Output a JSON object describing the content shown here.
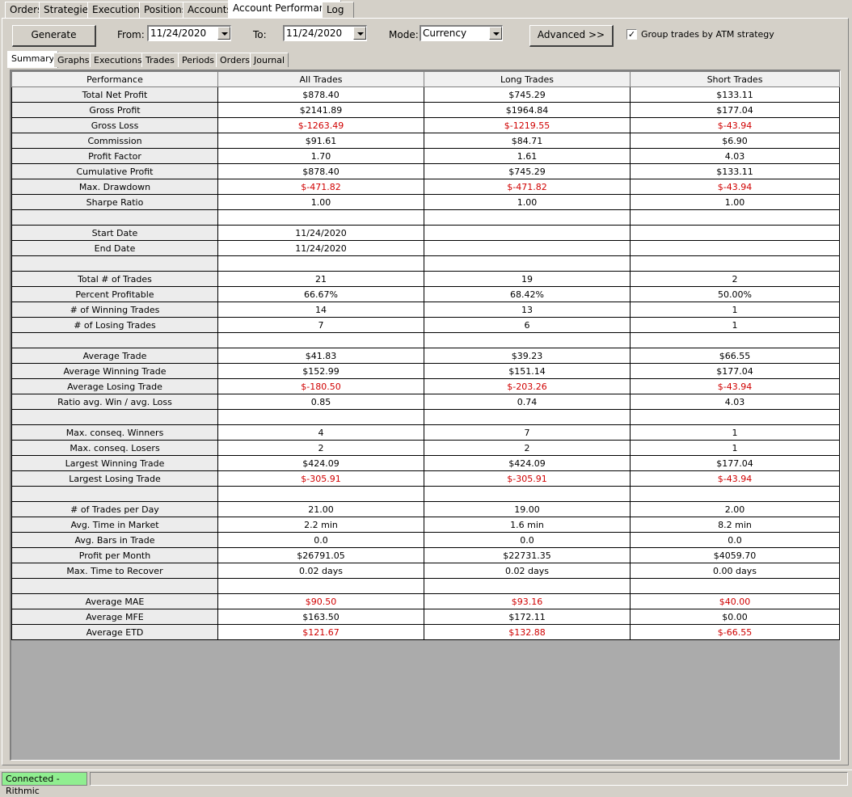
{
  "main_tabs": [
    "Orders",
    "Strategies",
    "Executions",
    "Positions",
    "Accounts",
    "Account Performance",
    "Log"
  ],
  "toolbar": {
    "generate_label": "Generate",
    "from_label": "From:",
    "from_value": "11/24/2020",
    "to_label": "To:",
    "to_value": "11/24/2020",
    "mode_label": "Mode:",
    "mode_value": "Currency",
    "advanced_label": "Advanced >>",
    "group_label": "Group trades by ATM strategy",
    "group_checked": true
  },
  "sub_tabs": [
    "Summary",
    "Graphs",
    "Executions",
    "Trades",
    "Periods",
    "Orders",
    "Journal"
  ],
  "table": {
    "headers": [
      "Performance",
      "All Trades",
      "Long Trades",
      "Short Trades"
    ],
    "rows": [
      {
        "label": "Total Net Profit",
        "all": "$878.40",
        "long": "$745.29",
        "short": "$133.11"
      },
      {
        "label": "Gross Profit",
        "all": "$2141.89",
        "long": "$1964.84",
        "short": "$177.04"
      },
      {
        "label": "Gross Loss",
        "all": "$-1263.49",
        "long": "$-1219.55",
        "short": "$-43.94",
        "neg": true
      },
      {
        "label": "Commission",
        "all": "$91.61",
        "long": "$84.71",
        "short": "$6.90"
      },
      {
        "label": "Profit Factor",
        "all": "1.70",
        "long": "1.61",
        "short": "4.03"
      },
      {
        "label": "Cumulative Profit",
        "all": "$878.40",
        "long": "$745.29",
        "short": "$133.11"
      },
      {
        "label": "Max. Drawdown",
        "all": "$-471.82",
        "long": "$-471.82",
        "short": "$-43.94",
        "neg": true
      },
      {
        "label": "Sharpe Ratio",
        "all": "1.00",
        "long": "1.00",
        "short": "1.00"
      },
      {
        "label": "",
        "all": "",
        "long": "",
        "short": ""
      },
      {
        "label": "Start Date",
        "all": "11/24/2020",
        "long": "",
        "short": ""
      },
      {
        "label": "End Date",
        "all": "11/24/2020",
        "long": "",
        "short": ""
      },
      {
        "label": "",
        "all": "",
        "long": "",
        "short": ""
      },
      {
        "label": "Total # of Trades",
        "all": "21",
        "long": "19",
        "short": "2"
      },
      {
        "label": "Percent Profitable",
        "all": "66.67%",
        "long": "68.42%",
        "short": "50.00%"
      },
      {
        "label": "# of Winning Trades",
        "all": "14",
        "long": "13",
        "short": "1"
      },
      {
        "label": "# of Losing Trades",
        "all": "7",
        "long": "6",
        "short": "1"
      },
      {
        "label": "",
        "all": "",
        "long": "",
        "short": ""
      },
      {
        "label": "Average Trade",
        "all": "$41.83",
        "long": "$39.23",
        "short": "$66.55"
      },
      {
        "label": "Average Winning Trade",
        "all": "$152.99",
        "long": "$151.14",
        "short": "$177.04"
      },
      {
        "label": "Average Losing Trade",
        "all": "$-180.50",
        "long": "$-203.26",
        "short": "$-43.94",
        "neg": true
      },
      {
        "label": "Ratio avg. Win / avg. Loss",
        "all": "0.85",
        "long": "0.74",
        "short": "4.03"
      },
      {
        "label": "",
        "all": "",
        "long": "",
        "short": ""
      },
      {
        "label": "Max. conseq. Winners",
        "all": "4",
        "long": "7",
        "short": "1"
      },
      {
        "label": "Max. conseq. Losers",
        "all": "2",
        "long": "2",
        "short": "1"
      },
      {
        "label": "Largest Winning Trade",
        "all": "$424.09",
        "long": "$424.09",
        "short": "$177.04"
      },
      {
        "label": "Largest Losing Trade",
        "all": "$-305.91",
        "long": "$-305.91",
        "short": "$-43.94",
        "neg": true
      },
      {
        "label": "",
        "all": "",
        "long": "",
        "short": ""
      },
      {
        "label": "# of Trades per Day",
        "all": "21.00",
        "long": "19.00",
        "short": "2.00"
      },
      {
        "label": "Avg. Time in Market",
        "all": "2.2 min",
        "long": "1.6 min",
        "short": "8.2 min"
      },
      {
        "label": "Avg. Bars in Trade",
        "all": "0.0",
        "long": "0.0",
        "short": "0.0"
      },
      {
        "label": "Profit per Month",
        "all": "$26791.05",
        "long": "$22731.35",
        "short": "$4059.70"
      },
      {
        "label": "Max. Time to Recover",
        "all": "0.02 days",
        "long": "0.02 days",
        "short": "0.00 days"
      },
      {
        "label": "",
        "all": "",
        "long": "",
        "short": ""
      },
      {
        "label": "Average MAE",
        "all": "$90.50",
        "long": "$93.16",
        "short": "$40.00",
        "neg": true
      },
      {
        "label": "Average MFE",
        "all": "$163.50",
        "long": "$172.11",
        "short": "$0.00"
      },
      {
        "label": "Average ETD",
        "all": "$121.67",
        "long": "$132.88",
        "short": "$-66.55",
        "neg": true
      }
    ]
  },
  "status": {
    "connection": "Connected - Rithmic"
  },
  "colors": {
    "negative": "#d00000",
    "connected": "#90ee90"
  }
}
